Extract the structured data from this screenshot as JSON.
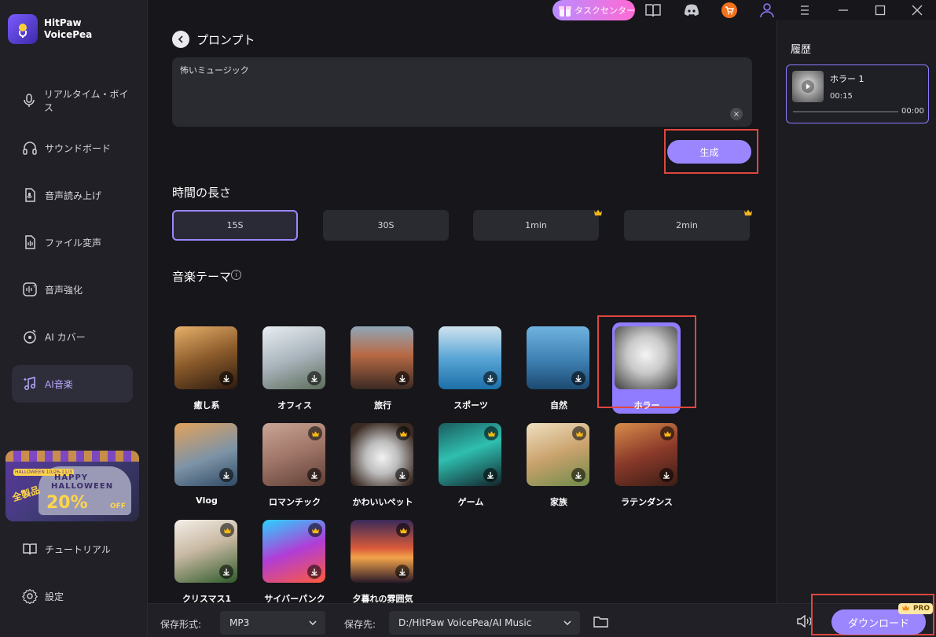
{
  "app": {
    "name_line1": "HitPaw",
    "name_line2": "VoicePea"
  },
  "sidebar": {
    "items": [
      {
        "label": "リアルタイム・ボイス",
        "icon": "realtime-voice-icon"
      },
      {
        "label": "サウンドボード",
        "icon": "headphones-icon"
      },
      {
        "label": "音声読み上げ",
        "icon": "text-to-speech-icon"
      },
      {
        "label": "ファイル変声",
        "icon": "file-audio-icon"
      },
      {
        "label": "音声強化",
        "icon": "enhance-icon"
      },
      {
        "label": "AI カバー",
        "icon": "music-disc-icon"
      },
      {
        "label": "AI音楽",
        "icon": "ai-music-icon",
        "active": true
      },
      {
        "label": "チュートリアル",
        "icon": "book-icon"
      },
      {
        "label": "設定",
        "icon": "gear-icon"
      }
    ],
    "promo": {
      "badge": "HALLOWEEN 10/26-11/3",
      "line1": "HAPPY",
      "line2": "HALLOWEEN",
      "side": "全製品",
      "discount": "20%",
      "off": "OFF"
    }
  },
  "topbar": {
    "task_center": "タスクセンター"
  },
  "prompt": {
    "title": "プロンプト",
    "value": "怖いミュージック",
    "generate": "生成"
  },
  "duration": {
    "title": "時間の長さ",
    "options": [
      {
        "label": "15S",
        "selected": true,
        "pro": false
      },
      {
        "label": "30S",
        "selected": false,
        "pro": false
      },
      {
        "label": "1min",
        "selected": false,
        "pro": true
      },
      {
        "label": "2min",
        "selected": false,
        "pro": true
      }
    ]
  },
  "themes": {
    "title": "音楽テーマ",
    "items": [
      {
        "label": "癒し系"
      },
      {
        "label": "オフィス"
      },
      {
        "label": "旅行"
      },
      {
        "label": "スポーツ"
      },
      {
        "label": "自然"
      },
      {
        "label": "ホラー",
        "selected": true
      },
      {
        "label": "Vlog"
      },
      {
        "label": "ロマンチック"
      },
      {
        "label": "かわいいペット"
      },
      {
        "label": "ゲーム"
      },
      {
        "label": "家族"
      },
      {
        "label": "ラテンダンス"
      },
      {
        "label": "クリスマス1"
      },
      {
        "label": "サイバーパンク"
      },
      {
        "label": "夕暮れの雰囲気"
      }
    ]
  },
  "bottom": {
    "format_label": "保存形式:",
    "format_value": "MP3",
    "dest_label": "保存先:",
    "dest_value": "D:/HitPaw VoicePea/AI Music",
    "download": "ダウンロード",
    "pro": "PRO"
  },
  "history": {
    "title": "履歴",
    "items": [
      {
        "name": "ホラー 1",
        "duration": "00:15",
        "position": "00:00"
      }
    ]
  },
  "colors": {
    "accent": "#9c86ff",
    "highlight": "#e0463f",
    "background": "#16161b"
  }
}
